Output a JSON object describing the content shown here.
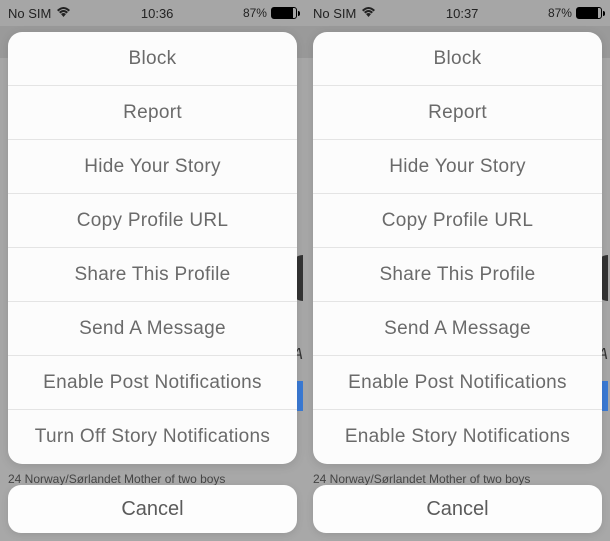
{
  "left": {
    "status": {
      "carrier": "No SIM",
      "time": "10:36",
      "battery_pct": "87%"
    },
    "menu": [
      "Block",
      "Report",
      "Hide Your Story",
      "Copy Profile URL",
      "Share This Profile",
      "Send A Message",
      "Enable Post Notifications",
      "Turn Off Story Notifications"
    ],
    "cancel": "Cancel",
    "bio": "24  Norway/Sørlandet  Mother of two boys"
  },
  "right": {
    "status": {
      "carrier": "No SIM",
      "time": "10:37",
      "battery_pct": "87%"
    },
    "menu": [
      "Block",
      "Report",
      "Hide Your Story",
      "Copy Profile URL",
      "Share This Profile",
      "Send A Message",
      "Enable Post Notifications",
      "Enable Story Notifications"
    ],
    "cancel": "Cancel",
    "bio": "24  Norway/Sørlandet  Mother of two boys"
  }
}
